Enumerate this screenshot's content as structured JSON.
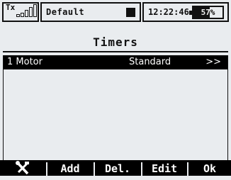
{
  "status": {
    "tx_label": "Tx",
    "model_name": "Default",
    "time": "12:22:46",
    "battery_label": "57%",
    "battery_level": 0.57
  },
  "screen": {
    "title": "Timers"
  },
  "timers": [
    {
      "name": "1 Motor",
      "mode": "Standard",
      "arrow": ">>"
    }
  ],
  "menu": {
    "tools_icon": "wrench-screwdriver-icon",
    "add_label": "Add",
    "delete_label": "Del.",
    "edit_label": "Edit",
    "ok_label": "Ok"
  },
  "colors": {
    "background": "#e9ecef",
    "foreground": "#111111",
    "highlight": "#000000"
  }
}
